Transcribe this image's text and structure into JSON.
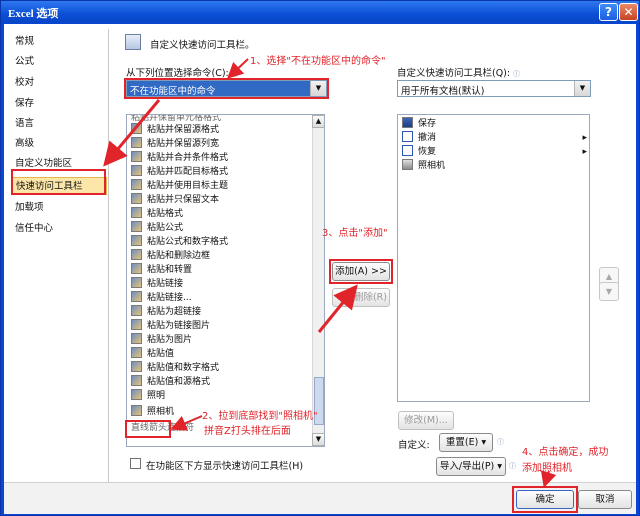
{
  "window": {
    "title": "Excel 选项",
    "help_glyph": "?",
    "close_glyph": "✕"
  },
  "nav": {
    "items": [
      "常规",
      "公式",
      "校对",
      "保存",
      "语言",
      "高级",
      "自定义功能区",
      "快速访问工具栏",
      "加载项",
      "信任中心"
    ]
  },
  "header": {
    "title": "自定义快速访问工具栏。"
  },
  "left_panel": {
    "choose_label": "从下列位置选择命令(C):",
    "choose_value": "不在功能区中的命令",
    "commands": [
      "粘贴并保留源格式",
      "粘贴并保留源列宽",
      "粘贴并合并条件格式",
      "粘贴并匹配目标格式",
      "粘贴并使用目标主题",
      "粘贴并只保留文本",
      "粘贴格式",
      "粘贴公式",
      "粘贴公式和数字格式",
      "粘贴和删除边框",
      "粘贴和转置",
      "粘贴链接",
      "粘贴链接...",
      "粘贴为超链接",
      "粘贴为链接图片",
      "粘贴为图片",
      "粘贴值",
      "粘贴值和数字格式",
      "粘贴值和源格式",
      "照明",
      "照相机"
    ],
    "partial_top": "粘贴并保留单元格格式",
    "partial_bottom": "直线箭头连接符",
    "below_ribbon_label": "在功能区下方显示快速访问工具栏(H)"
  },
  "right_panel": {
    "customize_label": "自定义快速访问工具栏(Q):",
    "customize_value": "用于所有文档(默认)",
    "items": [
      {
        "label": "保存",
        "has_arrow": false
      },
      {
        "label": "撤消",
        "has_arrow": true
      },
      {
        "label": "恢复",
        "has_arrow": true
      },
      {
        "label": "照相机",
        "has_arrow": false
      }
    ],
    "modify_button": "修改(M)...",
    "customize_text": "自定义:",
    "reset_button": "重置(E) ▾",
    "import_export_button": "导入/导出(P) ▾"
  },
  "middle": {
    "add_button": "添加(A) >>",
    "remove_button": "<< 删除(R)"
  },
  "footer": {
    "ok_button": "确定",
    "cancel_button": "取消"
  },
  "annotations": {
    "step1": "1、选择\"不在功能区中的命令\"",
    "step2_line1": "2、拉到底部找到\"照相机\"",
    "step2_line2": "拼音Z打头排在后面",
    "step3": "3、点击\"添加\"",
    "step4_line1": "4、点击确定，成功",
    "step4_line2": "添加照相机"
  },
  "colors": {
    "annotation_red": "#e1232a",
    "title_blue": "#0b4fd6",
    "selected_nav": "#fde7a8"
  },
  "icons": {
    "info": "ⓘ",
    "dropdown": "▼",
    "scroll_up": "▲",
    "scroll_down": "▼",
    "move_up": "▲",
    "move_down": "▼",
    "submenu": "▸"
  }
}
